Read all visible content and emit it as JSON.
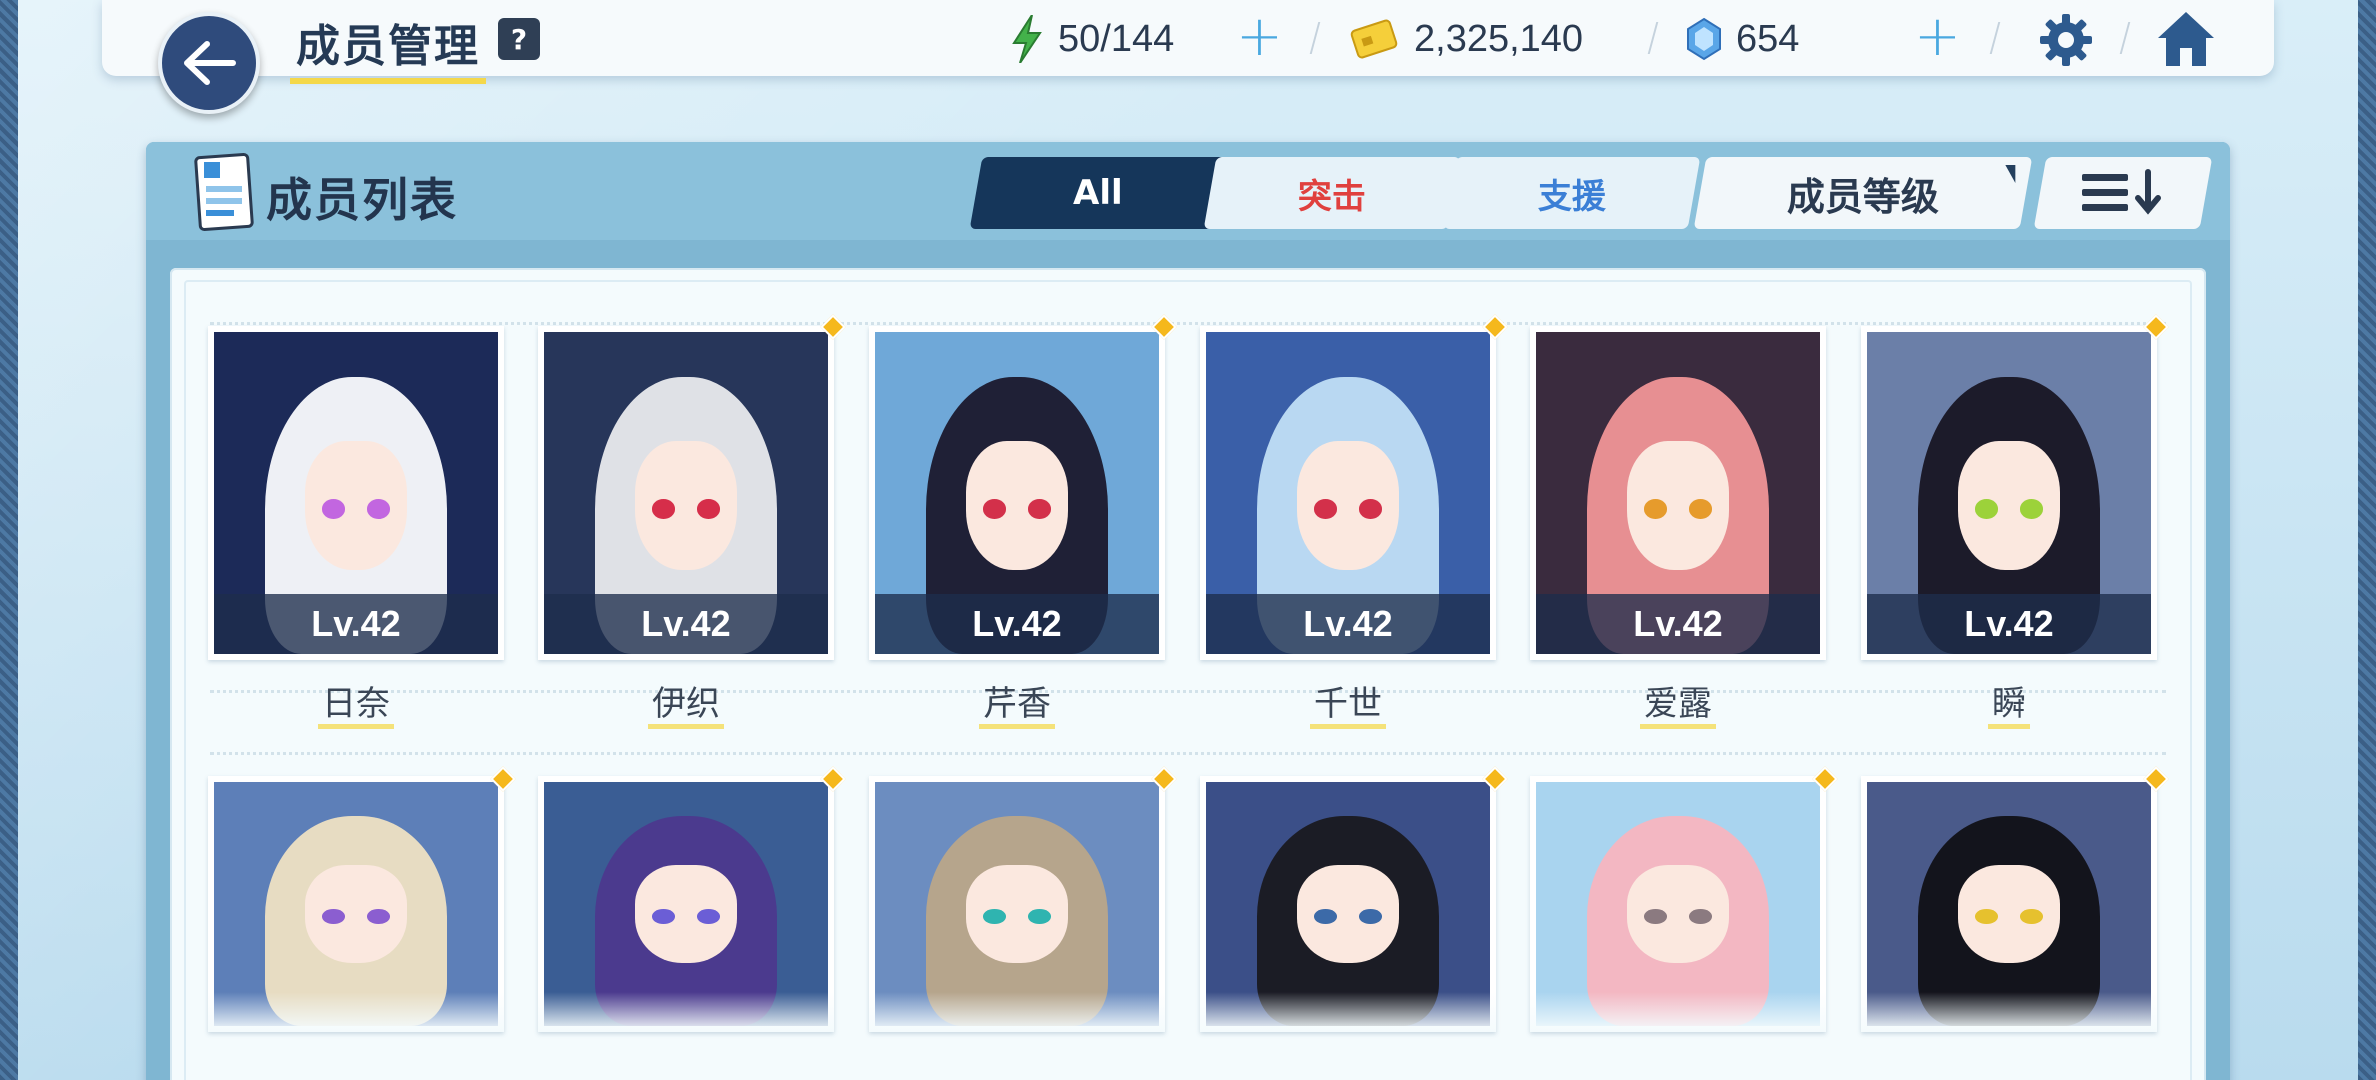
{
  "header": {
    "title": "成员管理",
    "help_label": "?",
    "stamina": "50/144",
    "credits": "2,325,140",
    "gems": "654"
  },
  "panel": {
    "title": "成员列表",
    "filters": [
      {
        "label": "All",
        "selected": true
      },
      {
        "label": "突击",
        "color": "#e0403e"
      },
      {
        "label": "支援",
        "color": "#3b7fd6"
      }
    ],
    "sort_label": "成员等级"
  },
  "members_row1": [
    {
      "name": "日奈",
      "level": "Lv.42",
      "new_dot": false,
      "hair": "#eef0f5",
      "bg": "#1c2a58",
      "eye": "#c266e0"
    },
    {
      "name": "伊织",
      "level": "Lv.42",
      "new_dot": true,
      "hair": "#dfe1e6",
      "bg": "#27365a",
      "eye": "#d62e4a"
    },
    {
      "name": "芹香",
      "level": "Lv.42",
      "new_dot": true,
      "hair": "#1f2036",
      "bg": "#6fa8d8",
      "eye": "#d3304a"
    },
    {
      "name": "千世",
      "level": "Lv.42",
      "new_dot": true,
      "hair": "#b9d8f2",
      "bg": "#3a5fa8",
      "eye": "#d3304a"
    },
    {
      "name": "爱露",
      "level": "Lv.42",
      "new_dot": false,
      "hair": "#e78f92",
      "bg": "#3a2b3e",
      "eye": "#e69b2c"
    },
    {
      "name": "瞬",
      "level": "Lv.42",
      "new_dot": true,
      "hair": "#1c1b2a",
      "bg": "#6b7fa8",
      "eye": "#9cd23a"
    }
  ],
  "members_row2": [
    {
      "new_dot": true,
      "hair": "#e7dcc2",
      "bg": "#5d7fb8",
      "eye": "#8b5ed0"
    },
    {
      "new_dot": true,
      "hair": "#4b3a8e",
      "bg": "#3a5d94",
      "eye": "#6b5ed6"
    },
    {
      "new_dot": true,
      "hair": "#b6a58c",
      "bg": "#6c8dc0",
      "eye": "#2fb4b0"
    },
    {
      "new_dot": true,
      "hair": "#1b1c25",
      "bg": "#3b4f88",
      "eye": "#3c6aa8"
    },
    {
      "new_dot": true,
      "hair": "#f3b7c2",
      "bg": "#a9d4ef",
      "eye": "#8b7a80"
    },
    {
      "new_dot": true,
      "hair": "#13141c",
      "bg": "#4a5a8a",
      "eye": "#e6c12e"
    }
  ],
  "icons": {
    "back": "arrow-left-icon",
    "stamina": "lightning-icon",
    "credits": "credit-card-icon",
    "gems": "gem-icon",
    "settings": "gear-icon",
    "home": "home-icon",
    "list": "document-list-icon",
    "order": "sort-order-icon"
  }
}
